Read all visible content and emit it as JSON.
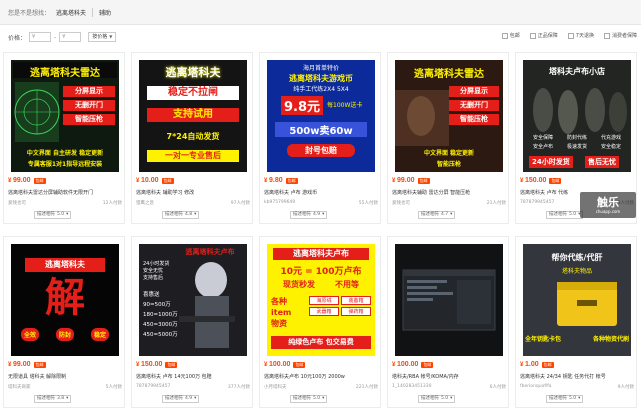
{
  "search": {
    "label": "您是不是想找：",
    "keyword": "逃离塔科夫",
    "crumb": "辅助"
  },
  "filters": {
    "price_label": "价格：",
    "price_from": "¥",
    "price_to": "¥",
    "sort_label": "按价格",
    "checks": [
      "包邮",
      "正品保障",
      "7天退换",
      "消费者保障"
    ]
  },
  "products": [
    {
      "price": "99.00",
      "title": "逃离塔科夫雷达分屏辅助软件无限开门",
      "seller": "爱钱也可",
      "sales": "12人付款",
      "rating_label": "描述相符",
      "rating": "5.0",
      "banner": {
        "headline": "逃离塔科夫雷达",
        "tags": [
          "分屏显示",
          "无删开门",
          "智能压枪"
        ],
        "bottom": [
          "中文界面 自主研发 稳定更新",
          "专属客服1对1指导远程安装"
        ]
      }
    },
    {
      "price": "10.00",
      "title": "逃离塔科夫 辅助学习 修改",
      "seller": "猎鹰之息",
      "sales": "97人付款",
      "rating_label": "描述相符",
      "rating": "4.8",
      "banner": {
        "headline": "逃离塔科夫",
        "lines": [
          "稳定不拉闸",
          "支持试用",
          "7*24自动发货",
          "一对一专业售后"
        ]
      }
    },
    {
      "price": "9.80",
      "title": "逃离塔科夫 卢布 游戏币",
      "seller": "kb975799649",
      "sales": "55人付款",
      "rating_label": "描述相符",
      "rating": "4.9",
      "banner": {
        "top": "海月首单特价",
        "headline": "逃离塔科夫游戏币",
        "sub": "纯手工代练2X4 5X4",
        "price_big": "9.8元",
        "amount": "500w卖60w",
        "tag1": "每100W送卡",
        "tag2": "封号包赔"
      }
    },
    {
      "price": "99.00",
      "title": "逃离塔科夫辅助 雷达分屏 智能压枪",
      "seller": "爱钱也可",
      "sales": "21人付款",
      "rating_label": "描述相符",
      "rating": "4.7",
      "banner": {
        "headline": "逃离塔科夫雷达",
        "tags": [
          "分屏显示",
          "无删开门",
          "智能压枪"
        ],
        "bottom": [
          "中文界面 稳定更新",
          "智能压枪"
        ]
      }
    },
    {
      "price": "150.00",
      "title": "逃离塔科夫 卢布 代练",
      "seller": "787879945457",
      "sales": "3人付款",
      "rating_label": "描述相符",
      "rating": "5.0",
      "banner": {
        "headline": "塔科夫卢布小店",
        "features": [
          "安全保障",
          "防封代练",
          "代充游戏",
          "安全卢布",
          "极速发货",
          "安全稳定"
        ],
        "bottom": "24小时发货",
        "bottom2": "售后无忧"
      }
    },
    {
      "price": "99.00",
      "title": "无限道具 塔科夫 解除限制",
      "seller": "塔科夫商家",
      "sales": "5人付款",
      "rating_label": "描述相符",
      "rating": "3.8",
      "banner": {
        "headline": "逃离塔科夫",
        "big": "解",
        "chips": [
          "全效",
          "防封",
          "稳定"
        ]
      }
    },
    {
      "price": "150.00",
      "title": "逃离塔科夫 卢布 14元100万 包赔",
      "seller": "787879945457",
      "sales": "377人付款",
      "rating_label": "描述相符",
      "rating": "4.9",
      "banner": {
        "headline": "逃离塔科夫卢布",
        "lines": [
          "24小时发货",
          "安全无忧",
          "支持售后"
        ],
        "prices": [
          "喜惠送",
          "90=500万",
          "180=1000万",
          "450=3000万",
          "450=5000万"
        ]
      }
    },
    {
      "price": "100.00",
      "title": "逃离塔科夫卢布 10元100万 2000w",
      "seller": "小月塔科夫",
      "sales": "221人付款",
      "rating_label": "描述相符",
      "rating": "5.0",
      "banner": {
        "headline": "逃离塔科夫卢布",
        "price_line": "10元 = 100万卢布",
        "sub_left": "现货秒发",
        "sub_right": "不用等",
        "section": "各种item",
        "section2": "物资",
        "chips": [
          "海原绒",
          "装备箱",
          "武器箱",
          "弹药箱"
        ],
        "bottom": "纯绿色卢布 包交易费"
      }
    },
    {
      "price": "100.00",
      "title": "塔科夫/RBA 帐号/KOMA/内存",
      "seller": "1_140283451330",
      "sales": "6人付款",
      "rating_label": "描述相符",
      "rating": "5.0",
      "banner": {}
    },
    {
      "price": "1.00",
      "title": "逃离塔科夫 24/34 钥匙 任务代打 帐号",
      "seller": "fberionquofifa",
      "sales": "9人付款",
      "rating_label": "描述相符",
      "rating": "5.0",
      "banner": {
        "headline": "帮你代练/代肝",
        "sub": "塔科夫物品",
        "bottom": "全年钥匙卡包",
        "bottom2": "各种物资代刷"
      }
    }
  ],
  "watermark": {
    "big": "触乐",
    "small": "chuapp.com"
  },
  "colors": {
    "price": "#ff4400",
    "hot_badge": "#ff4400",
    "banner_yellow": "#fff200",
    "banner_red": "#e41f19"
  }
}
